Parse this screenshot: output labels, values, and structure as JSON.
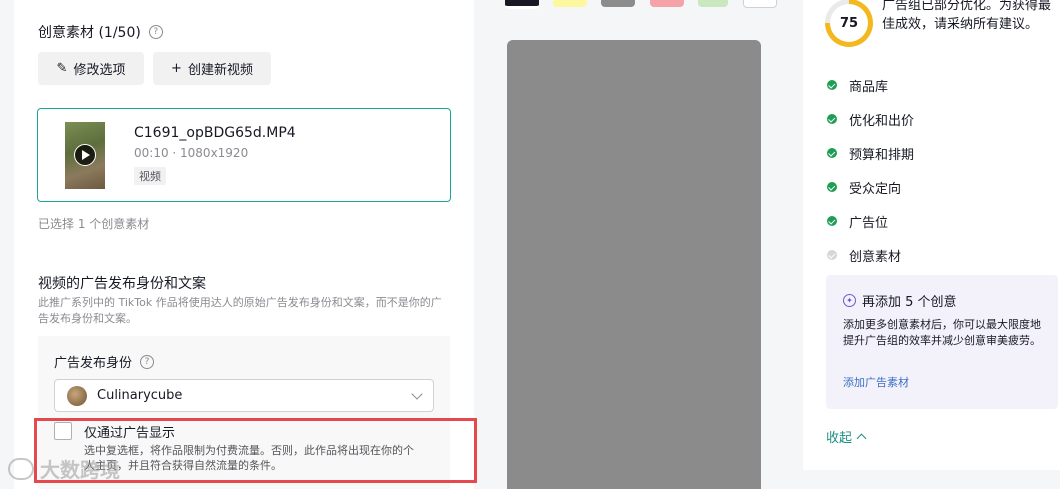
{
  "creative": {
    "section_title": "创意素材 (1/50)",
    "edit_button": "修改选项",
    "create_button": "创建新视频",
    "media": {
      "name": "C1691_opBDG65d.MP4",
      "meta": "00:10 · 1080x1920",
      "tag": "视频"
    },
    "selected_count": "已选择 1 个创意素材"
  },
  "identity": {
    "title": "视频的广告发布身份和文案",
    "description": "此推广系列中的 TikTok 作品将使用达人的原始广告发布身份和文案，而不是你的广告发布身份和文案。",
    "publisher_label": "广告发布身份",
    "publisher_value": "Culinarycube",
    "ad_only_label": "仅通过广告显示",
    "ad_only_desc": "选中复选框，将作品限制为付费流量。否则，此作品将出现在你的个人主页，并且符合获得自然流量的条件。"
  },
  "watermark": "大数跨境",
  "optimization": {
    "score": "75",
    "score_value": 75,
    "score_text": "广告组已部分优化。为获得最佳成效，请采纳所有建议。",
    "checklist": [
      {
        "label": "商品库",
        "done": true
      },
      {
        "label": "优化和出价",
        "done": true
      },
      {
        "label": "预算和排期",
        "done": true
      },
      {
        "label": "受众定向",
        "done": true
      },
      {
        "label": "广告位",
        "done": true
      },
      {
        "label": "创意素材",
        "done": false
      }
    ],
    "suggestion": {
      "title": "再添加 5 个创意",
      "description": "添加更多创意素材后，你可以最大限度地提升广告组的效率并减少创意审美疲劳。",
      "link": "添加广告素材"
    },
    "collapse_label": "收起"
  },
  "colors": {
    "accent_teal": "#1ea59a",
    "highlight_red": "#e5484d",
    "score_yellow": "#f3b81e",
    "check_green": "#1e9e55"
  }
}
